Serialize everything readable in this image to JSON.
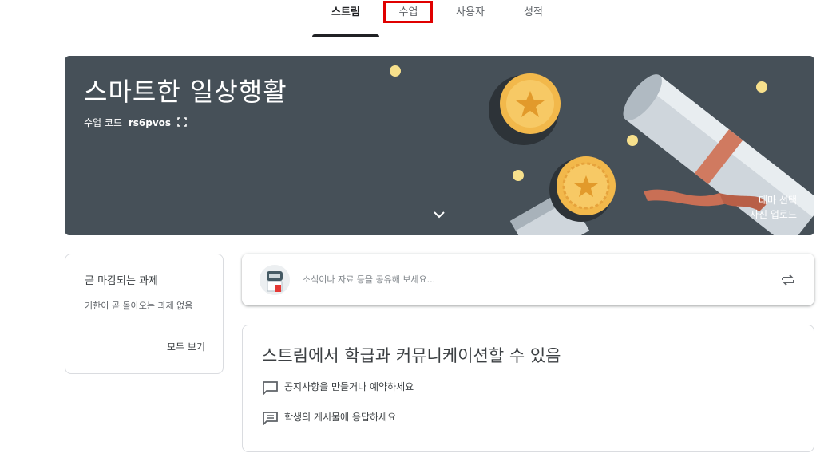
{
  "tabs": [
    {
      "label": "스트림",
      "active": true
    },
    {
      "label": "수업",
      "active": false,
      "highlighted": true
    },
    {
      "label": "사용자",
      "active": false
    },
    {
      "label": "성적",
      "active": false
    }
  ],
  "banner": {
    "title": "스마트한 일상행활",
    "class_code_label": "수업 코드",
    "class_code_value": "rs6pvos",
    "select_theme": "테마 선택",
    "upload_photo": "사진 업로드",
    "background_color": "#465058"
  },
  "due": {
    "title": "곧 마감되는 과제",
    "empty_text": "기한이 곧 돌아오는 과제 없음",
    "view_all": "모두 보기"
  },
  "share": {
    "placeholder": "소식이나 자료 등을 공유해 보세요...",
    "repost_icon": "repost-icon"
  },
  "info": {
    "title": "스트림에서 학급과 커뮤니케이션할 수 있음",
    "items": [
      {
        "icon": "announcement-icon",
        "text": "공지사항을 만들거나 예약하세요"
      },
      {
        "icon": "comment-icon",
        "text": "학생의 게시물에 응답하세요"
      }
    ]
  },
  "colors": {
    "highlight": "#e00000",
    "active_tab_underline": "#202124",
    "coin_gold": "#f2b84b"
  }
}
